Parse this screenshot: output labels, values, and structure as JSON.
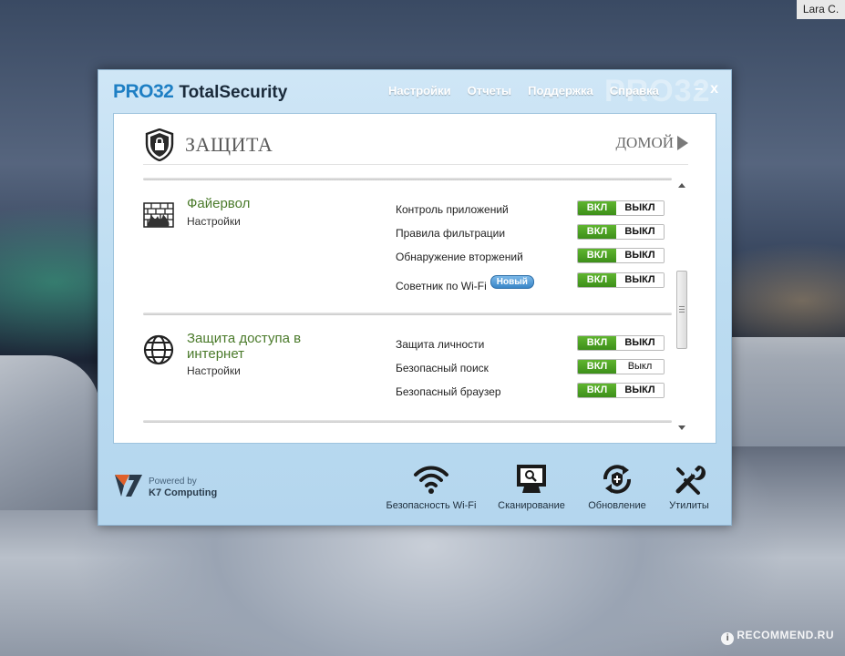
{
  "desktop": {
    "user_label": "Lara C.",
    "watermark": "RECOMMEND.RU",
    "watermark_mark": "i"
  },
  "app": {
    "brand_prefix": "PRO32",
    "brand_suffix": "TotalSecurity",
    "bg_logo": "PRO32",
    "nav": [
      "Настройки",
      "Отчеты",
      "Поддержка",
      "Справка"
    ],
    "minimize": "–",
    "close": "x"
  },
  "section": {
    "title": "ЗАЩИТА",
    "home_label": "ДОМОЙ"
  },
  "features": [
    {
      "title": "Файервол",
      "settings": "Настройки",
      "rows": [
        {
          "label": "Контроль приложений",
          "on": "ВКЛ",
          "off": "ВЫКЛ"
        },
        {
          "label": "Правила фильтрации",
          "on": "ВКЛ",
          "off": "ВЫКЛ"
        },
        {
          "label": "Обнаружение вторжений",
          "on": "ВКЛ",
          "off": "ВЫКЛ"
        },
        {
          "label": "Советник по Wi-Fi",
          "badge": "Новый",
          "on": "ВКЛ",
          "off": "ВЫКЛ"
        }
      ]
    },
    {
      "title": "Защита доступа в интернет",
      "settings": "Настройки",
      "rows": [
        {
          "label": "Защита личности",
          "on": "ВКЛ",
          "off": "ВЫКЛ"
        },
        {
          "label": "Безопасный поиск",
          "on": "ВКЛ",
          "off": "Выкл"
        },
        {
          "label": "Безопасный браузер",
          "on": "ВКЛ",
          "off": "ВЫКЛ"
        }
      ]
    }
  ],
  "footer": {
    "powered_by": "Powered by",
    "company": "K7 Computing",
    "tools": [
      {
        "label": "Безопасность Wi-Fi",
        "icon": "wifi-icon"
      },
      {
        "label": "Сканирование",
        "icon": "scan-icon"
      },
      {
        "label": "Обновление",
        "icon": "update-icon"
      },
      {
        "label": "Утилиты",
        "icon": "tools-icon"
      }
    ]
  }
}
